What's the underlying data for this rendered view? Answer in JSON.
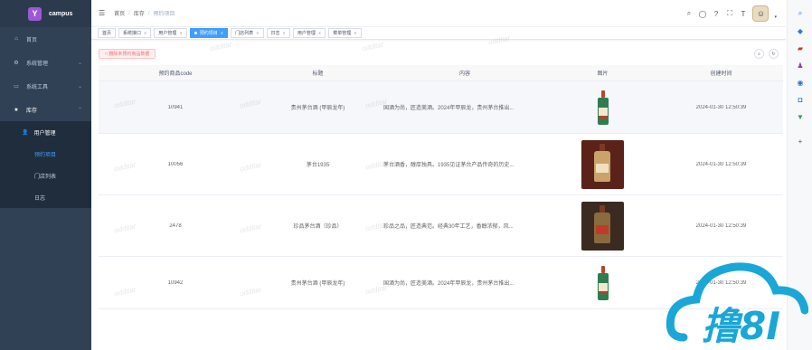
{
  "app": {
    "logo_letter": "Y",
    "name": "campus"
  },
  "sidebar": {
    "items": [
      {
        "icon": "home-icon",
        "glyph": "⌂",
        "label": "首页"
      },
      {
        "icon": "gear-icon",
        "glyph": "⚙",
        "label": "系统管理",
        "arrow": "⌄"
      },
      {
        "icon": "tools-icon",
        "glyph": "▭",
        "label": "系统工具",
        "arrow": "⌄"
      },
      {
        "icon": "star-icon",
        "glyph": "★",
        "label": "库存",
        "arrow": "⌃"
      }
    ],
    "submenu": {
      "group": {
        "glyph": "👤",
        "label": "用户管理"
      },
      "items": [
        {
          "label": "预约项目",
          "active": true
        },
        {
          "label": "门店列表"
        },
        {
          "label": "日志"
        }
      ]
    }
  },
  "header": {
    "breadcrumb": [
      "首页",
      "库存",
      "预约项目"
    ],
    "icons": [
      "search-icon",
      "github-icon",
      "help-icon",
      "fullscreen-icon",
      "font-size-icon"
    ]
  },
  "tags": [
    {
      "label": "首页",
      "closable": false
    },
    {
      "label": "系统接口",
      "closable": true
    },
    {
      "label": "用户管理",
      "closable": true
    },
    {
      "label": "预约项目",
      "closable": true,
      "active": true
    },
    {
      "label": "门店列表",
      "closable": true
    },
    {
      "label": "日志",
      "closable": true
    },
    {
      "label": "用户管理",
      "closable": true
    },
    {
      "label": "菜单管理",
      "closable": true
    }
  ],
  "toolbar": {
    "delete_label": "□ 删除未预约商品数据",
    "search_toggle": "⌕",
    "refresh": "↻"
  },
  "table": {
    "columns": [
      "预约商品code",
      "标题",
      "内容",
      "图片",
      "创建时间"
    ],
    "rows": [
      {
        "code": "10941",
        "title": "贵州茅台酒 (甲辰龙年)",
        "content": "国酒为尚，匠造美酒。2024年甲辰龙，贵州茅台推出...",
        "image": "bottle",
        "created": "2024-01-30 12:50:39"
      },
      {
        "code": "10056",
        "title": "茅台1935",
        "content": "茅台酒香，醇厚独具。1935见证茅台产品传奇的历史...",
        "image": "photo-red",
        "created": "2024-01-30 12:50:39"
      },
      {
        "code": "2478",
        "title": "珍品茅台酒（珍品）",
        "content": "珍品之品，匠造典范。经典30年工艺，香醇浓郁，风...",
        "image": "photo-dark",
        "created": "2024-01-30 12:50:39"
      },
      {
        "code": "10942",
        "title": "贵州茅台酒 (甲辰龙年)",
        "content": "国酒为尚，匠造美酒。2024年甲辰龙，贵州茅台推出...",
        "image": "bottle",
        "created": "2024-01-30 12:50:39"
      }
    ]
  },
  "watermark": "odditar",
  "brand": {
    "text": "撸8I",
    "color": "#1aa7d8"
  },
  "rightbar": {
    "icons": [
      {
        "name": "search-icon",
        "glyph": "⌕",
        "color": "#3a6ee8"
      },
      {
        "name": "tag-icon",
        "glyph": "◆",
        "color": "#2f7be5"
      },
      {
        "name": "briefcase-icon",
        "glyph": "▰",
        "color": "#c0392b"
      },
      {
        "name": "person-icon",
        "glyph": "♟",
        "color": "#8e44ad"
      },
      {
        "name": "circle-icon",
        "glyph": "◉",
        "color": "#2a6fdb"
      },
      {
        "name": "outlook-icon",
        "glyph": "◘",
        "color": "#0f6cbd"
      },
      {
        "name": "cart-icon",
        "glyph": "▼",
        "color": "#27a35a"
      },
      {
        "name": "plus-icon",
        "glyph": "+",
        "color": "#555555"
      }
    ]
  }
}
